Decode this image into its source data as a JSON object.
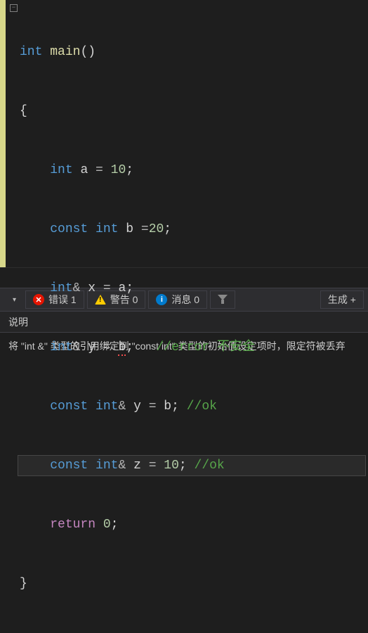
{
  "code": {
    "ret_type": "int",
    "fn_name": "main",
    "parens": "()",
    "open_brace": "{",
    "decl_a_type": "int",
    "decl_a_name": "a",
    "decl_a_val": "10",
    "decl_b_mod": "const",
    "decl_b_type": "int",
    "decl_b_name": "b",
    "decl_b_val": "20",
    "decl_x_type": "int",
    "decl_x_ref": "&",
    "decl_x_name": "x",
    "decl_x_rhs": "a",
    "decl_y_type": "int",
    "decl_y_ref": "&",
    "decl_y_name": "y",
    "decl_y_rhs": "b",
    "comment_y": "//error 不安全",
    "decl_y2_mod": "const",
    "decl_y2_type": "int",
    "decl_y2_ref": "&",
    "decl_y2_name": "y",
    "decl_y2_rhs": "b",
    "comment_y2": "//ok",
    "decl_z_mod": "const",
    "decl_z_type": "int",
    "decl_z_ref": "&",
    "decl_z_name": "z",
    "decl_z_val": "10",
    "comment_z": "//ok",
    "ret_kw": "return",
    "ret_val": "0",
    "close_brace": "}",
    "eq": " = ",
    "eq2": " =",
    "semi": ";",
    "sp4": "    ",
    "sp8": "        "
  },
  "status": {
    "errors_label": "错误 1",
    "warnings_label": "警告 0",
    "messages_label": "消息 0",
    "build_label": "生成 +"
  },
  "error_panel": {
    "header": "说明",
    "body": "将 \"int &\" 类型的引用绑定到 \"const int\" 类型的初始值设定项时，限定符被丢弃"
  }
}
